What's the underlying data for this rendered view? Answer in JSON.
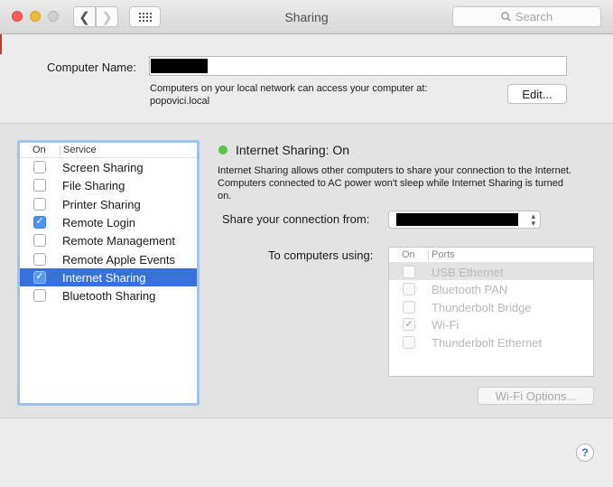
{
  "window": {
    "title": "Sharing",
    "search_placeholder": "Search"
  },
  "computer_name": {
    "label": "Computer Name:",
    "value": ""
  },
  "network_info": {
    "line1": "Computers on your local network can access your computer at:",
    "line2": "popovici.local",
    "edit_label": "Edit..."
  },
  "services": {
    "header_on": "On",
    "header_service": "Service",
    "items": [
      {
        "label": "Screen Sharing",
        "checked": false,
        "selected": false
      },
      {
        "label": "File Sharing",
        "checked": false,
        "selected": false
      },
      {
        "label": "Printer Sharing",
        "checked": false,
        "selected": false
      },
      {
        "label": "Remote Login",
        "checked": true,
        "selected": false
      },
      {
        "label": "Remote Management",
        "checked": false,
        "selected": false
      },
      {
        "label": "Remote Apple Events",
        "checked": false,
        "selected": false
      },
      {
        "label": "Internet Sharing",
        "checked": true,
        "selected": true
      },
      {
        "label": "Bluetooth Sharing",
        "checked": false,
        "selected": false
      }
    ]
  },
  "detail": {
    "status": "Internet Sharing: On",
    "status_color": "#5bc24a",
    "description": "Internet Sharing allows other computers to share your connection to the Internet. Computers connected to AC power won't sleep while Internet Sharing is turned on.",
    "share_from_label": "Share your connection from:",
    "to_label": "To computers using:",
    "ports_header_on": "On",
    "ports_header_ports": "Ports",
    "ports": [
      {
        "label": "USB Ethernet",
        "checked": false,
        "highlighted": true
      },
      {
        "label": "Bluetooth PAN",
        "checked": false,
        "highlighted": false
      },
      {
        "label": "Thunderbolt Bridge",
        "checked": false,
        "highlighted": false
      },
      {
        "label": "Wi-Fi",
        "checked": true,
        "highlighted": false
      },
      {
        "label": "Thunderbolt Ethernet",
        "checked": false,
        "highlighted": false
      }
    ],
    "wifi_options_label": "Wi-Fi Options..."
  },
  "help_label": "?",
  "colors": {
    "selection": "#3872d8",
    "checkbox_checked": "#4c93f3",
    "list_focus_ring": "#9ec3ee"
  }
}
